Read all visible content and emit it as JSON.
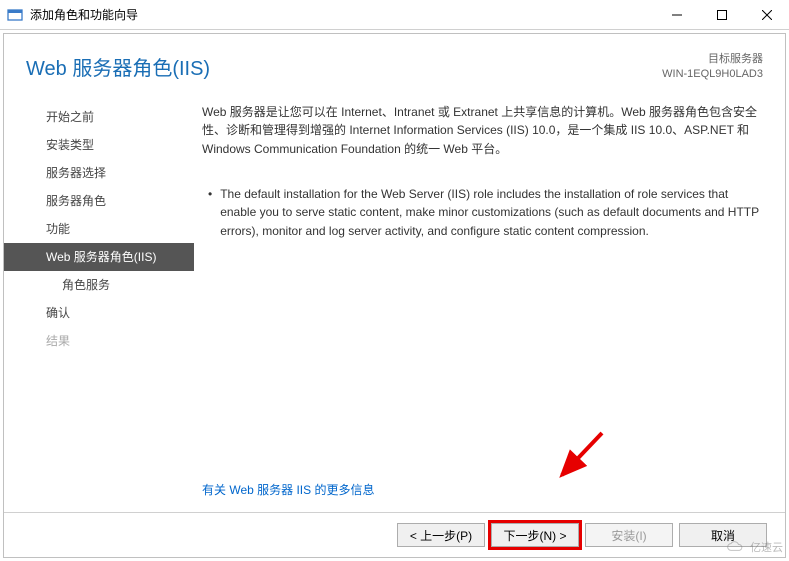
{
  "window": {
    "title": "添加角色和功能向导"
  },
  "header": {
    "page_title": "Web 服务器角色(IIS)",
    "target_label": "目标服务器",
    "target_value": "WIN-1EQL9H0LAD3"
  },
  "sidebar": {
    "items": [
      {
        "label": "开始之前",
        "selected": false,
        "indent": false,
        "disabled": false
      },
      {
        "label": "安装类型",
        "selected": false,
        "indent": false,
        "disabled": false
      },
      {
        "label": "服务器选择",
        "selected": false,
        "indent": false,
        "disabled": false
      },
      {
        "label": "服务器角色",
        "selected": false,
        "indent": false,
        "disabled": false
      },
      {
        "label": "功能",
        "selected": false,
        "indent": false,
        "disabled": false
      },
      {
        "label": "Web 服务器角色(IIS)",
        "selected": true,
        "indent": false,
        "disabled": false
      },
      {
        "label": "角色服务",
        "selected": false,
        "indent": true,
        "disabled": false
      },
      {
        "label": "确认",
        "selected": false,
        "indent": false,
        "disabled": false
      },
      {
        "label": "结果",
        "selected": false,
        "indent": false,
        "disabled": true
      }
    ]
  },
  "content": {
    "intro": "Web 服务器是让您可以在 Internet、Intranet 或 Extranet 上共享信息的计算机。Web 服务器角色包含安全性、诊断和管理得到增强的 Internet Information Services (IIS) 10.0，是一个集成 IIS 10.0、ASP.NET 和 Windows Communication Foundation 的统一 Web 平台。",
    "bullets": [
      "The default installation for the Web Server (IIS) role includes the installation of role services that enable you to serve static content, make minor customizations (such as default documents and HTTP errors), monitor and log server activity, and configure static content compression."
    ],
    "more_link": "有关 Web 服务器 IIS 的更多信息"
  },
  "footer": {
    "prev": "< 上一步(P)",
    "next": "下一步(N) >",
    "install": "安装(I)",
    "cancel": "取消"
  },
  "watermark": {
    "text": "亿速云"
  }
}
